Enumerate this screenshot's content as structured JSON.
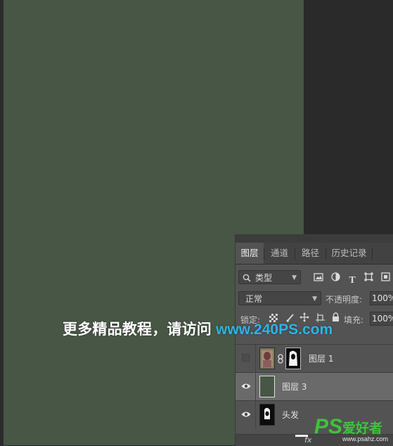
{
  "layers_panel": {
    "tabs": [
      "图层",
      "通道",
      "路径",
      "历史记录"
    ],
    "active_tab": "图层",
    "filter": {
      "kind_label": "类型"
    },
    "blend_mode": "正常",
    "opacity_label": "不透明度:",
    "opacity_value": "100%",
    "lock_label": "锁定:",
    "fill_label": "填充:",
    "fill_value": "100%",
    "layers": [
      {
        "name": "图层 1",
        "visible": false,
        "selected": false
      },
      {
        "name": "图层 3",
        "visible": true,
        "selected": true
      },
      {
        "name": "头发",
        "visible": true,
        "selected": false
      }
    ],
    "footer_fx": "fx"
  },
  "canvas": {
    "fill_color": "#475645"
  },
  "watermark": {
    "text": "更多精品教程，请访问",
    "url": "www.240PS.com"
  },
  "logo": {
    "ps": "PS",
    "cn": "爱好者",
    "url": "www.psahz.com"
  },
  "colors": {
    "panel": "#535353",
    "selected_row": "#6a6a6a",
    "url_blue": "#2bb5e8",
    "logo_green": "#3fc33c"
  }
}
